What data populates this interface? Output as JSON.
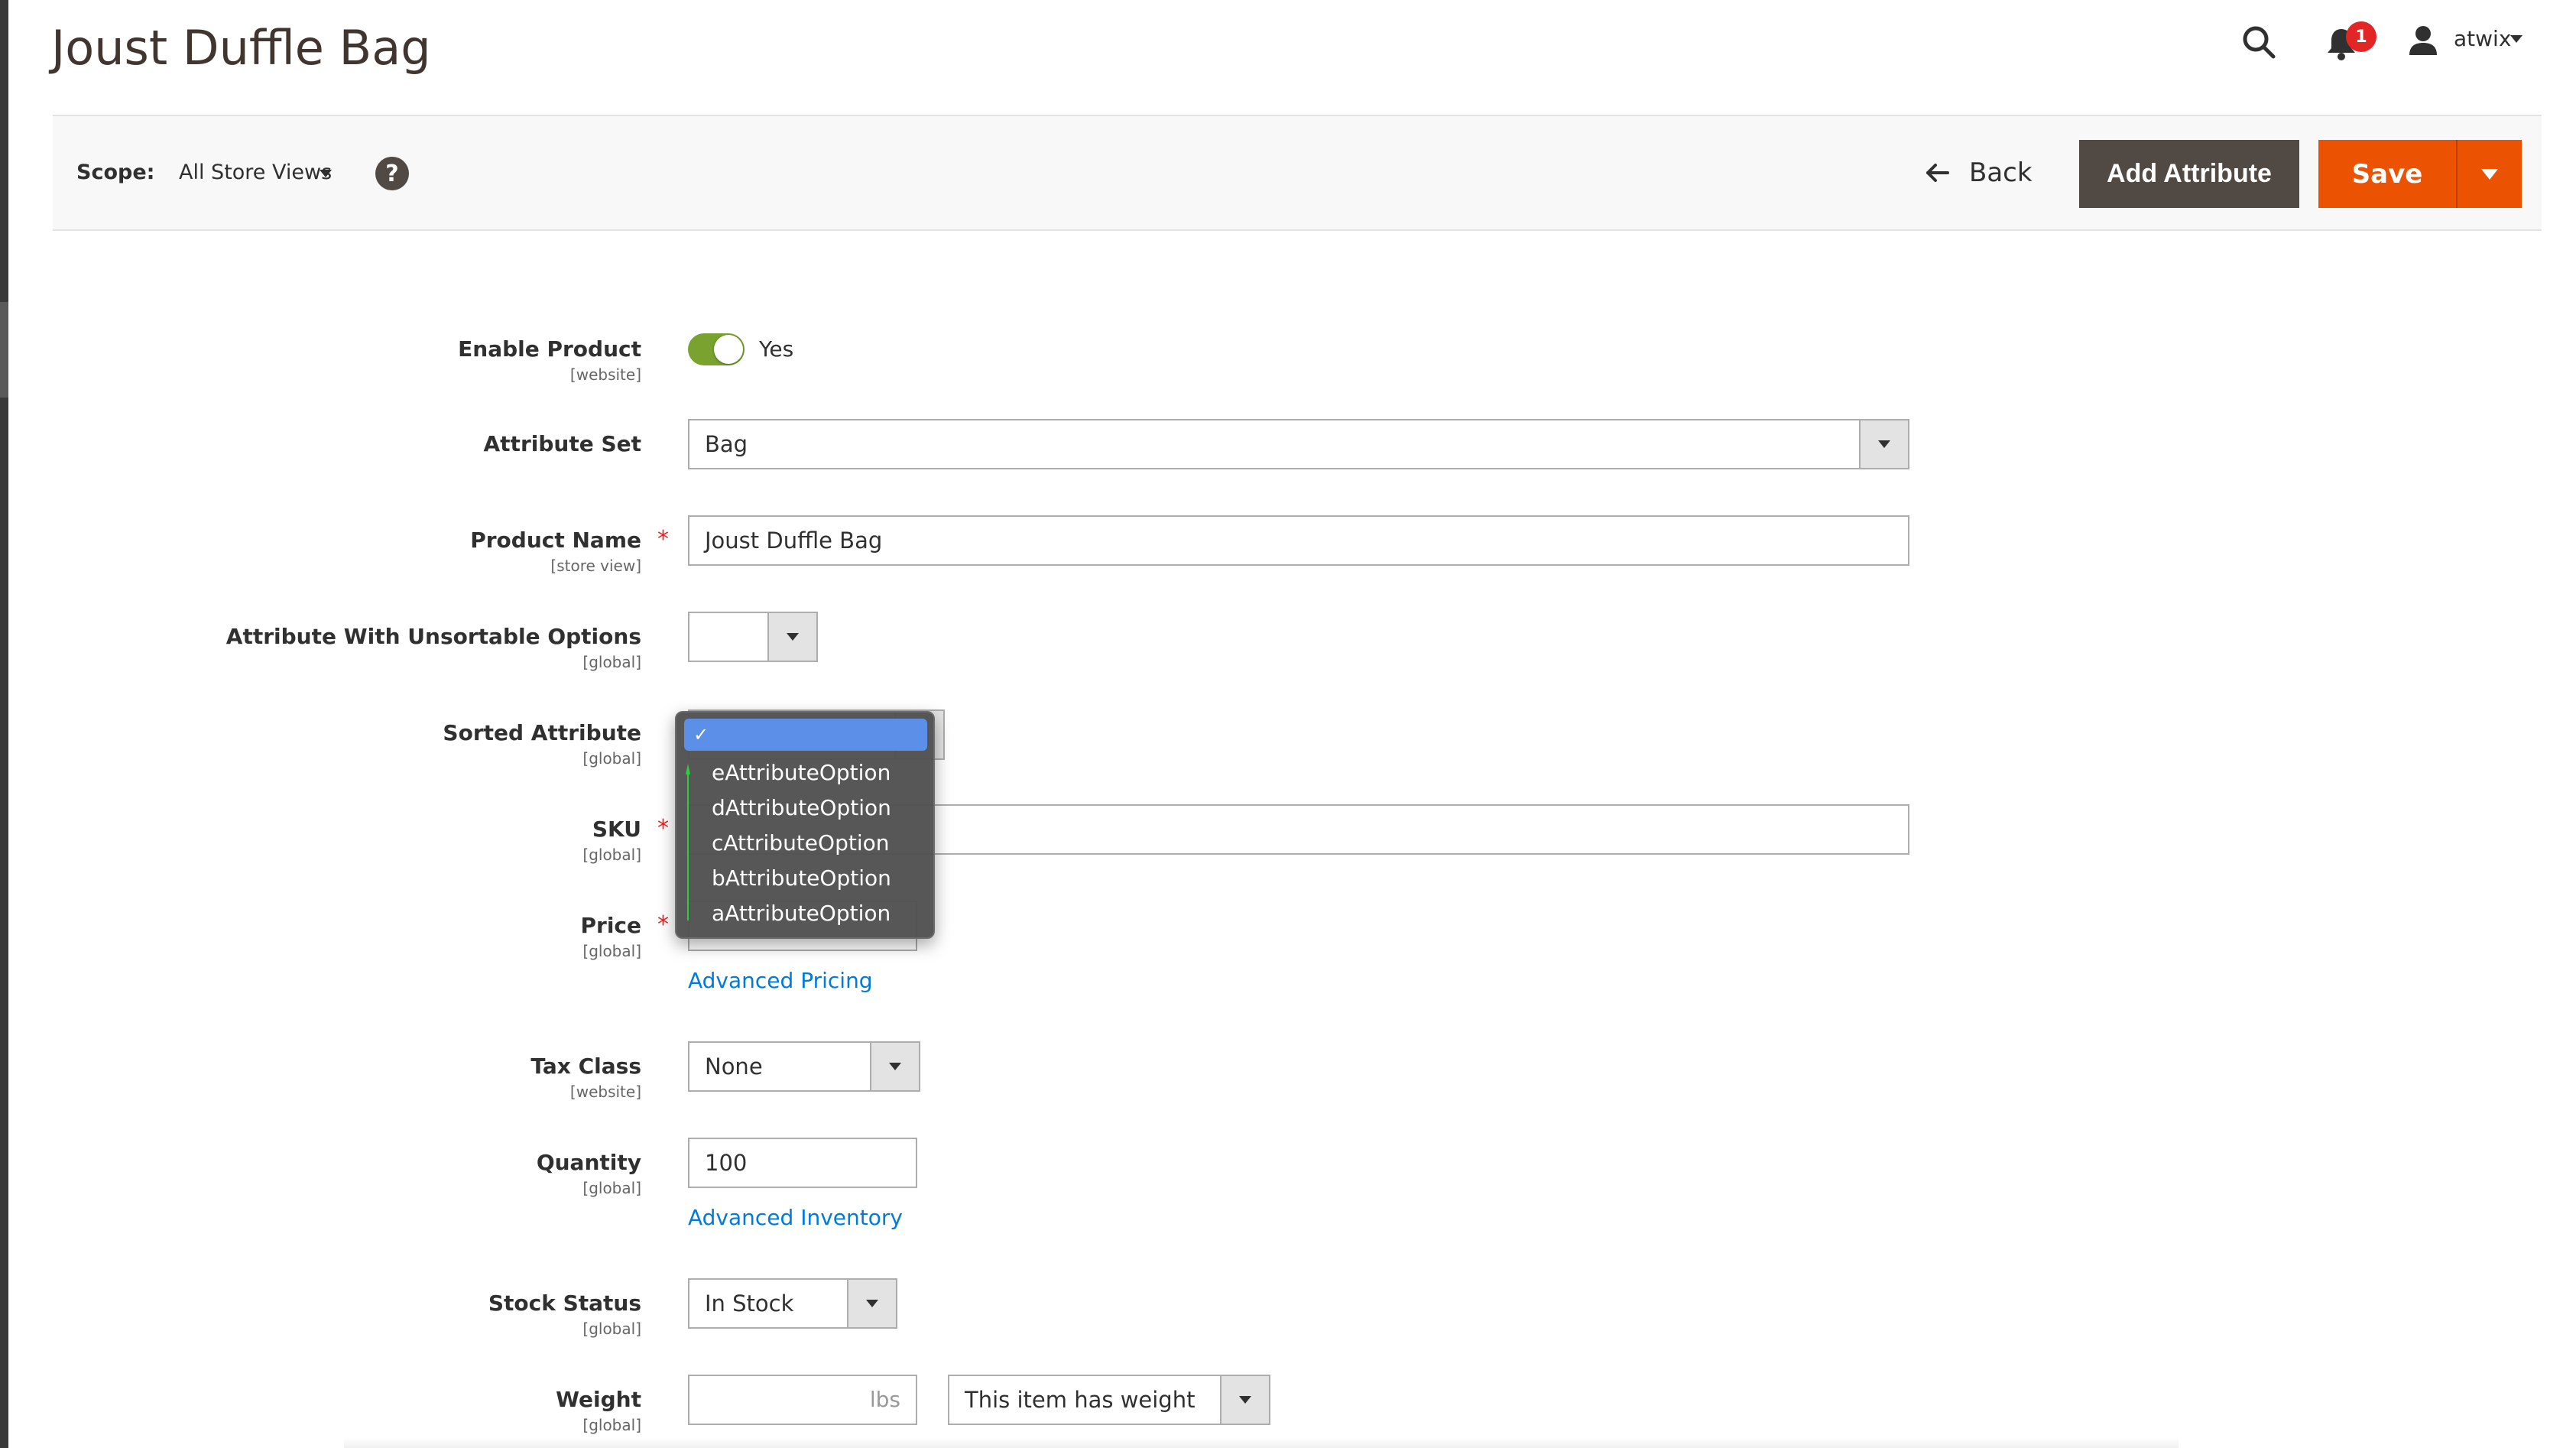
{
  "header": {
    "title": "Joust Duffle Bag",
    "notification_count": "1",
    "user_name": "atwix"
  },
  "toolbar": {
    "scope_label": "Scope:",
    "scope_value": "All Store Views",
    "help_glyph": "?",
    "back_label": "Back",
    "add_attribute_label": "Add Attribute",
    "save_label": "Save"
  },
  "form": {
    "enable_product": {
      "label": "Enable Product",
      "scope": "[website]",
      "value": "Yes",
      "enabled": true
    },
    "attribute_set": {
      "label": "Attribute Set",
      "value": "Bag"
    },
    "product_name": {
      "label": "Product Name",
      "scope": "[store view]",
      "value": "Joust Duffle Bag",
      "required": true
    },
    "unsortable": {
      "label": "Attribute With Unsortable Options",
      "scope": "[global]",
      "value": ""
    },
    "sorted": {
      "label": "Sorted Attribute",
      "scope": "[global]",
      "selected_glyph": "✓",
      "options": [
        "eAttributeOption",
        "dAttributeOption",
        "cAttributeOption",
        "bAttributeOption",
        "aAttributeOption"
      ]
    },
    "sku": {
      "label": "SKU",
      "scope": "[global]",
      "value": "",
      "required": true
    },
    "price": {
      "label": "Price",
      "scope": "[global]",
      "value": "",
      "required": true,
      "link": "Advanced Pricing"
    },
    "tax_class": {
      "label": "Tax Class",
      "scope": "[website]",
      "value": "None"
    },
    "quantity": {
      "label": "Quantity",
      "scope": "[global]",
      "value": "100",
      "link": "Advanced Inventory"
    },
    "stock_status": {
      "label": "Stock Status",
      "scope": "[global]",
      "value": "In Stock"
    },
    "weight": {
      "label": "Weight",
      "scope": "[global]",
      "value": "",
      "unit": "lbs",
      "type_value": "This item has weight"
    }
  },
  "colors": {
    "brand_orange": "#eb5202",
    "dark_button": "#514943",
    "toggle_on": "#79a22e",
    "link_blue": "#007bdb",
    "required_red": "#e22626",
    "popup_highlight": "#5b8fe8"
  },
  "icons": [
    "search-icon",
    "bell-icon",
    "user-icon",
    "help-icon",
    "back-arrow-icon",
    "chevron-down-icon",
    "checkmark-icon"
  ]
}
